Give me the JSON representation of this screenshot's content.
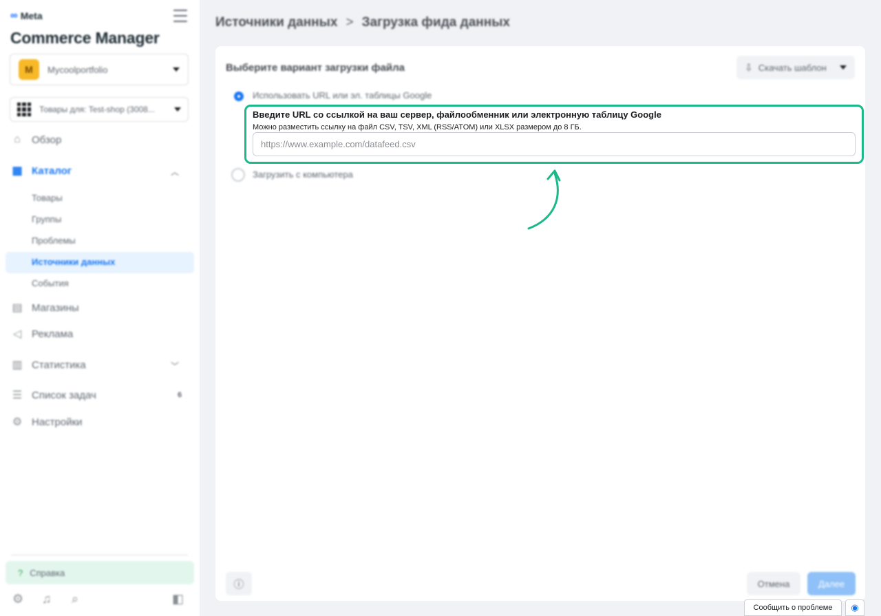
{
  "sidebar": {
    "brand": "Meta",
    "app_title": "Commerce Manager",
    "account": {
      "initial": "M",
      "name": "Mycoolportfolio"
    },
    "catalog_selector": {
      "label": "Товары для: Test-shop (3008..."
    },
    "nav": {
      "overview": "Обзор",
      "catalog": "Каталог",
      "catalog_sub": {
        "products": "Товары",
        "groups": "Группы",
        "problems": "Проблемы",
        "data_sources": "Источники данных",
        "events": "События"
      },
      "shops": "Магазины",
      "ads": "Реклама",
      "stats": "Статистика",
      "tasks": "Список задач",
      "tasks_count": "6",
      "settings": "Настройки"
    },
    "help": "Справка"
  },
  "breadcrumb": {
    "parent": "Источники данных",
    "separator": ">",
    "current": "Загрузка фида данных"
  },
  "card": {
    "title": "Выберите вариант загрузки файла",
    "template_button": "Скачать шаблон",
    "option_url": {
      "label": "Использовать URL или эл. таблицы Google",
      "selected": true,
      "heading": "Введите URL со ссылкой на ваш сервер, файлообменник или электронную таблицу Google",
      "description": "Можно разместить ссылку на файл CSV, TSV, XML (RSS/ATOM) или XLSX размером до 8 ГБ.",
      "input_value": "",
      "input_placeholder": "https://www.example.com/datafeed.csv"
    },
    "option_upload": {
      "label": "Загрузить с компьютера",
      "selected": false
    },
    "cancel_button": "Отмена",
    "next_button": "Далее"
  },
  "footer": {
    "report_problem": "Сообщить о проблеме"
  },
  "colors": {
    "accent": "#1877f2",
    "highlight": "#1bb98a",
    "next_disabled": "#8fc1f8"
  }
}
